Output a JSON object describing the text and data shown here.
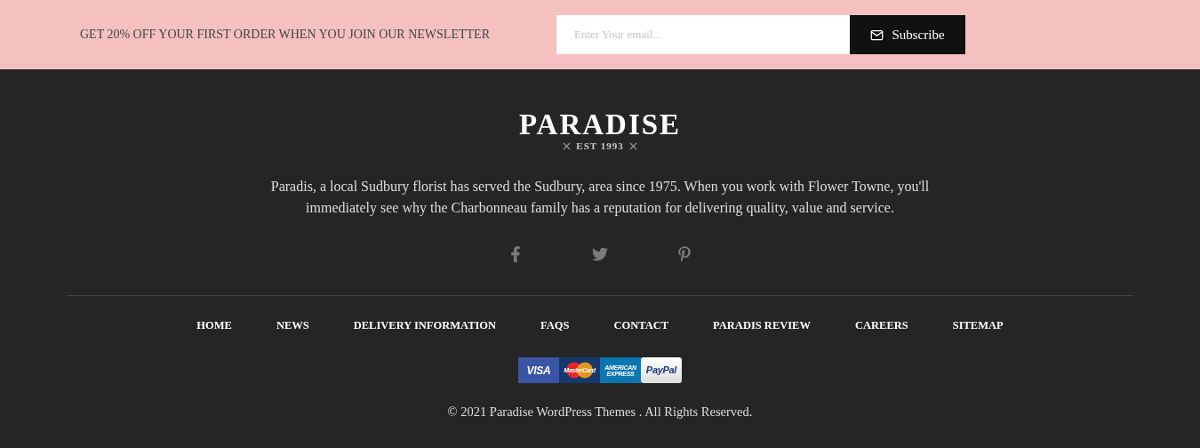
{
  "newsletter": {
    "text": "GET 20% OFF YOUR FIRST ORDER WHEN YOU JOIN OUR NEWSLETTER",
    "placeholder": "Enter Your email...",
    "button": "Subscribe"
  },
  "logo": {
    "name": "PARADISE",
    "tagline": "EST 1993"
  },
  "about": "Paradis, a local Sudbury florist has served the Sudbury, area since 1975. When you work with Flower Towne, you'll immediately see why the Charbonneau family has a reputation for delivering quality, value and service.",
  "social": [
    {
      "kind": "facebook"
    },
    {
      "kind": "twitter"
    },
    {
      "kind": "pinterest"
    }
  ],
  "nav": [
    "HOME",
    "NEWS",
    "DELIVERY INFORMATION",
    "FAQS",
    "CONTACT",
    "PARADIS REVIEW",
    "CAREERS",
    "SITEMAP"
  ],
  "payments": [
    {
      "kind": "visa",
      "label": "VISA"
    },
    {
      "kind": "mastercard",
      "label": "MasterCard"
    },
    {
      "kind": "amex",
      "label": "AMERICAN EXPRESS"
    },
    {
      "kind": "paypal",
      "label": "PayPal"
    }
  ],
  "copyright": "© 2021 Paradise WordPress Themes . All Rights Reserved."
}
